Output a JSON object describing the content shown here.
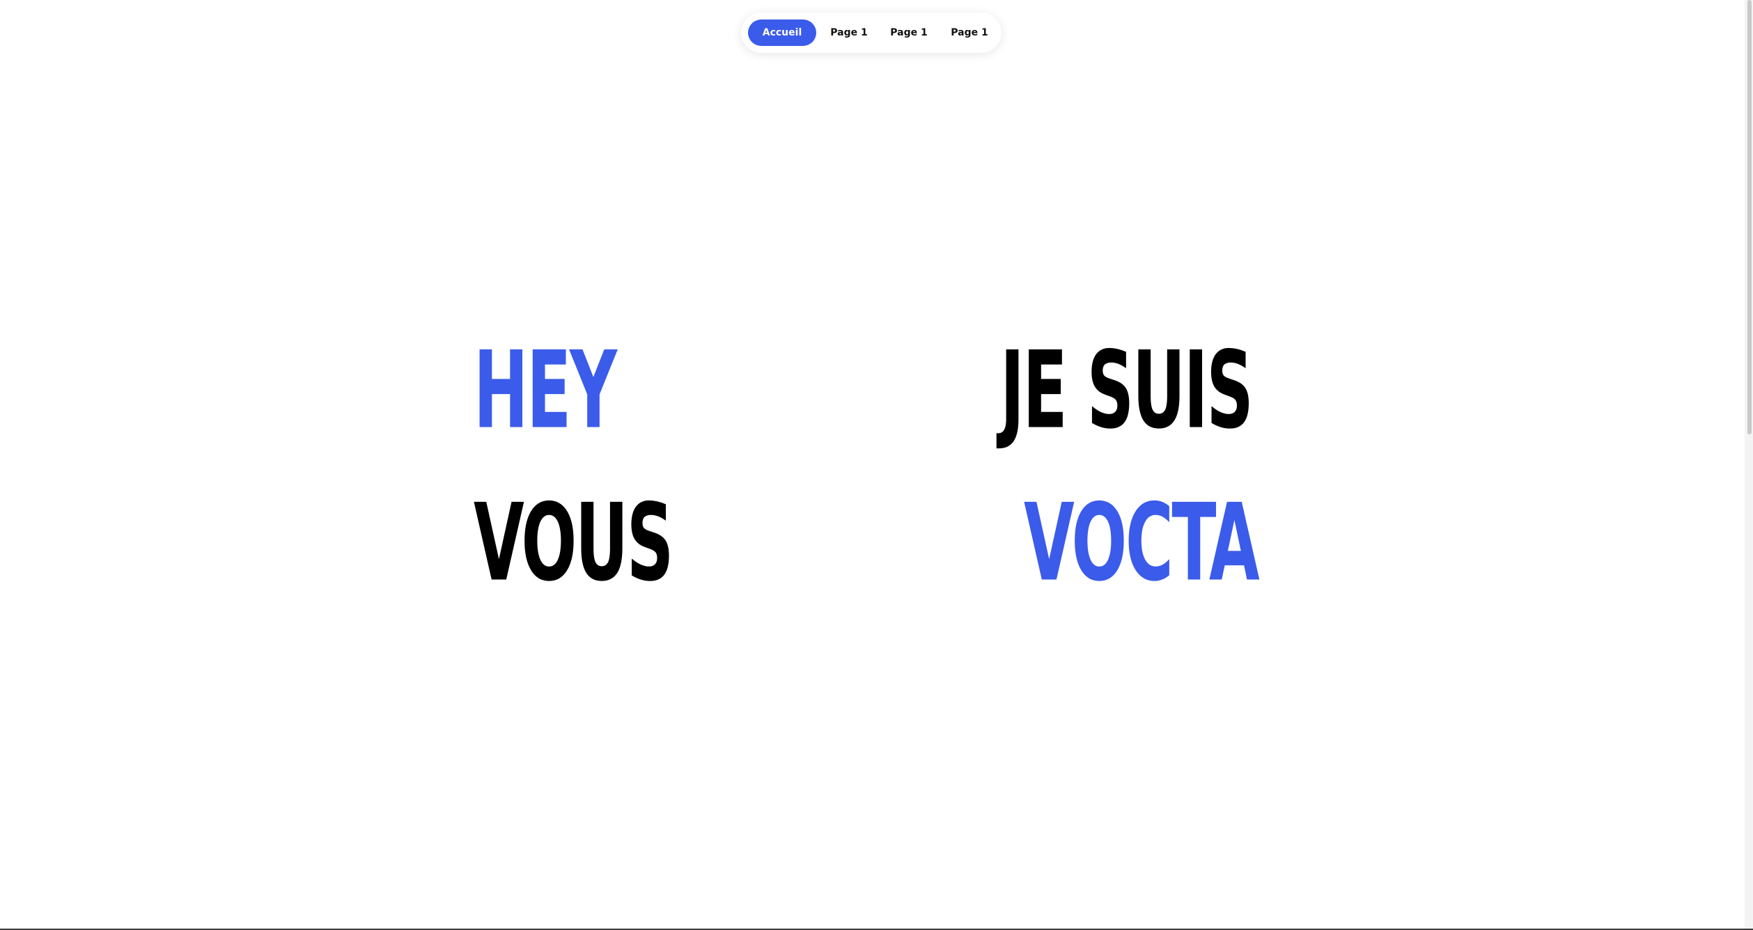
{
  "nav": {
    "items": [
      {
        "label": "Accueil",
        "active": true
      },
      {
        "label": "Page 1",
        "active": false
      },
      {
        "label": "Page 1",
        "active": false
      },
      {
        "label": "Page 1",
        "active": false
      }
    ]
  },
  "hero": {
    "words": [
      {
        "text": "HEY",
        "color": "#3b5bea"
      },
      {
        "text": "JE SUIS",
        "color": "#000000"
      },
      {
        "text": "VOUS",
        "color": "#000000"
      },
      {
        "text": "VOCTA",
        "color": "#3b5bea"
      }
    ]
  },
  "colors": {
    "accent": "#3b5bea",
    "text": "#000000",
    "background": "#ffffff"
  }
}
